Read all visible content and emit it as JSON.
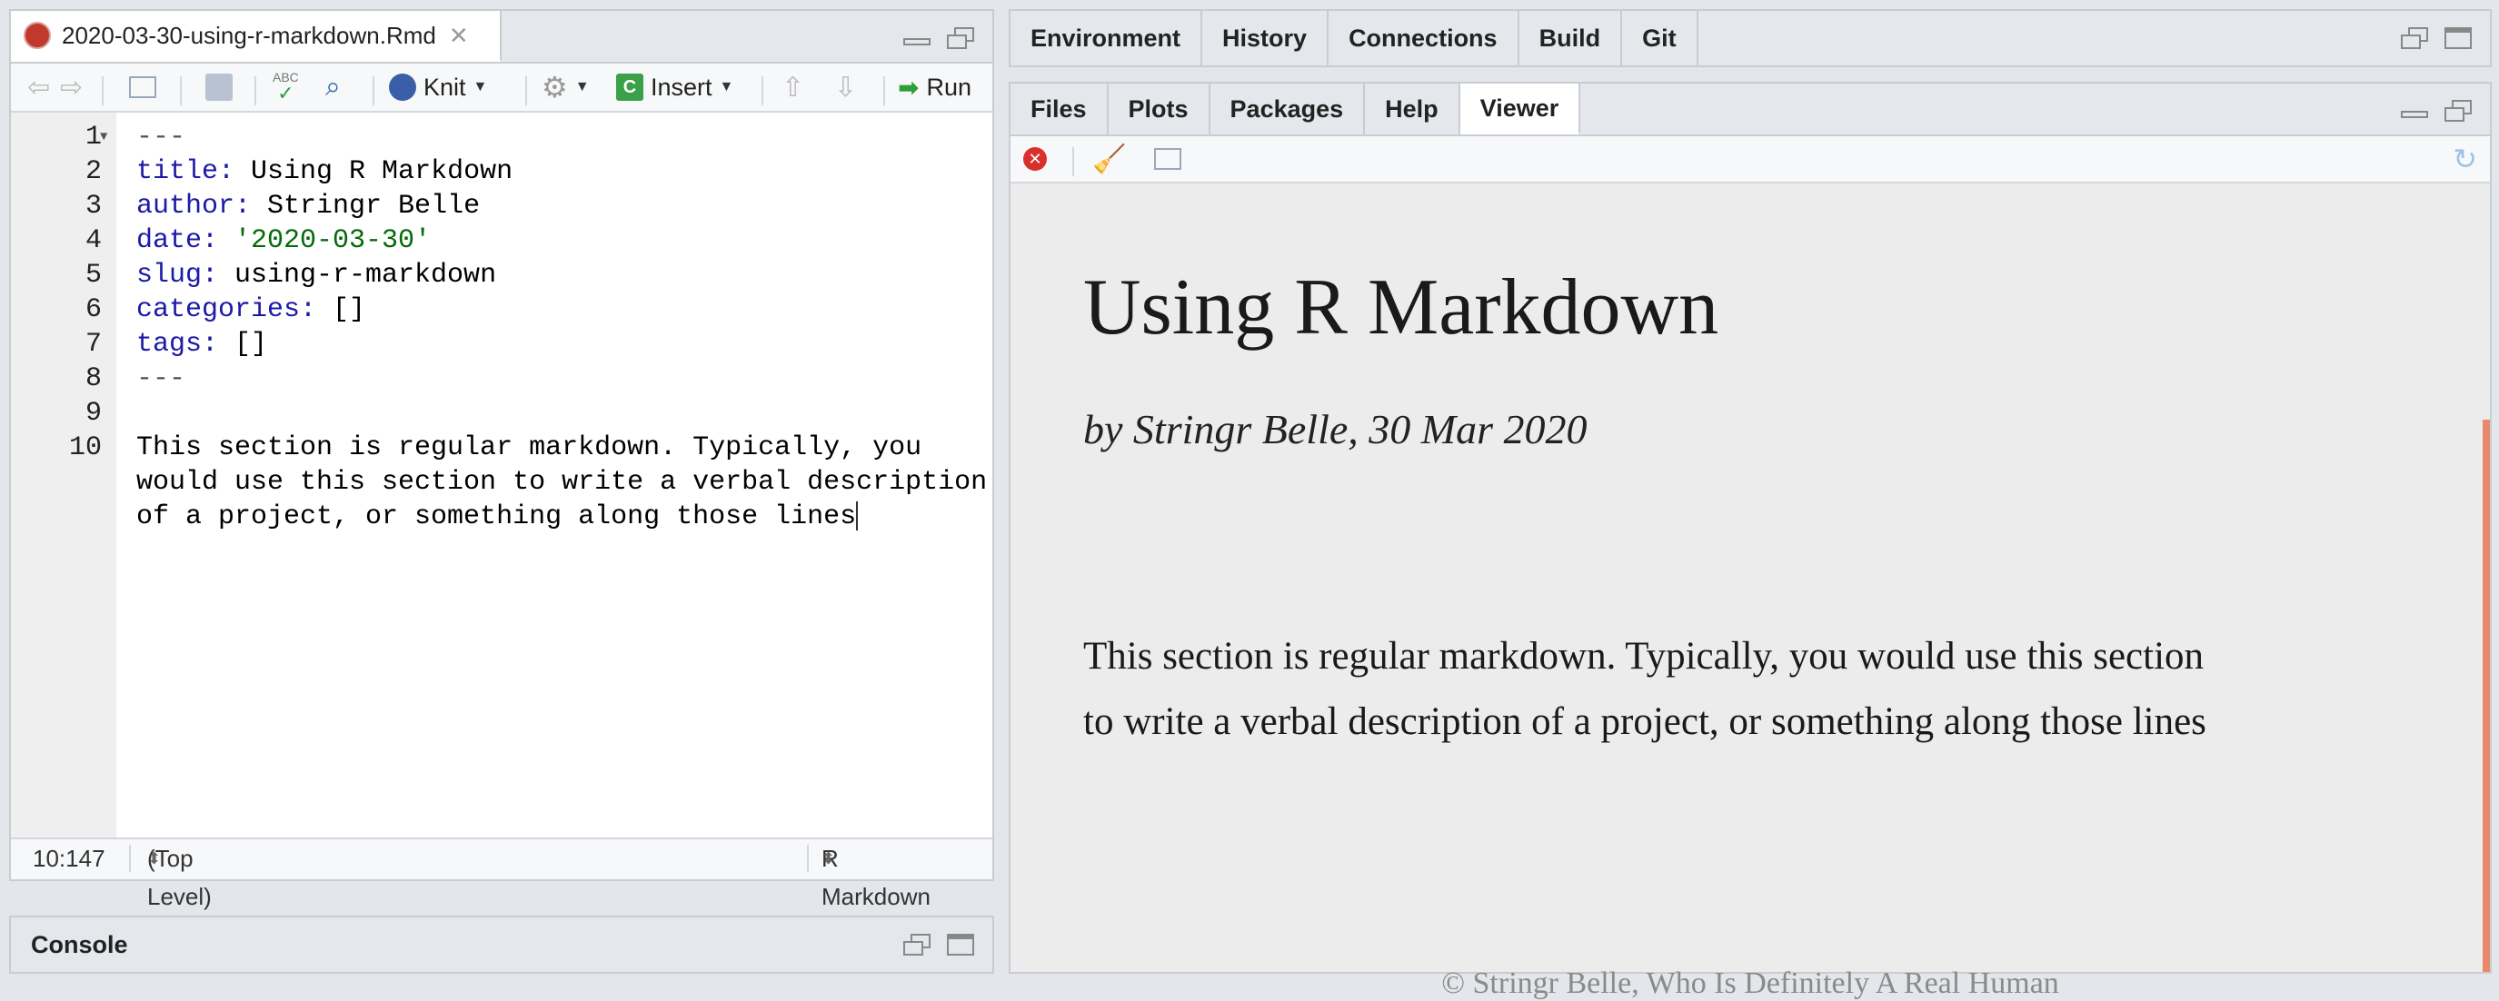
{
  "editor": {
    "file_tab": "2020-03-30-using-r-markdown.Rmd",
    "toolbar": {
      "knit": "Knit",
      "insert": "Insert",
      "run": "Run",
      "abc": "ABC"
    },
    "lines": [
      {
        "n": "1",
        "parts": [
          {
            "t": "---",
            "c": "g"
          }
        ]
      },
      {
        "n": "2",
        "parts": [
          {
            "t": "title:",
            "c": "k"
          },
          {
            "t": " Using R Markdown",
            "c": ""
          }
        ]
      },
      {
        "n": "3",
        "parts": [
          {
            "t": "author:",
            "c": "k"
          },
          {
            "t": " Stringr Belle",
            "c": ""
          }
        ]
      },
      {
        "n": "4",
        "parts": [
          {
            "t": "date:",
            "c": "k"
          },
          {
            "t": " ",
            "c": ""
          },
          {
            "t": "'2020-03-30'",
            "c": "s"
          }
        ]
      },
      {
        "n": "5",
        "parts": [
          {
            "t": "slug:",
            "c": "k"
          },
          {
            "t": " using-r-markdown",
            "c": ""
          }
        ]
      },
      {
        "n": "6",
        "parts": [
          {
            "t": "categories:",
            "c": "k"
          },
          {
            "t": " []",
            "c": ""
          }
        ]
      },
      {
        "n": "7",
        "parts": [
          {
            "t": "tags:",
            "c": "k"
          },
          {
            "t": " []",
            "c": ""
          }
        ]
      },
      {
        "n": "8",
        "parts": [
          {
            "t": "---",
            "c": "g"
          }
        ]
      },
      {
        "n": "9",
        "parts": []
      },
      {
        "n": "10",
        "parts": [
          {
            "t": "This section is regular markdown. Typically, you",
            "c": ""
          }
        ]
      },
      {
        "n": "",
        "parts": [
          {
            "t": "would use this section to write a verbal description",
            "c": ""
          }
        ]
      },
      {
        "n": "",
        "parts": [
          {
            "t": "of a project, or something along those lines",
            "c": ""
          }
        ]
      }
    ],
    "status": {
      "position": "10:147",
      "scope": "(Top Level)",
      "mode": "R Markdown"
    }
  },
  "console": {
    "title": "Console"
  },
  "top_right_tabs": [
    "Environment",
    "History",
    "Connections",
    "Build",
    "Git"
  ],
  "bottom_right_tabs": [
    "Files",
    "Plots",
    "Packages",
    "Help",
    "Viewer"
  ],
  "bottom_right_active": "Viewer",
  "viewer": {
    "title": "Using R Markdown",
    "byline": "by Stringr Belle, 30 Mar 2020",
    "body_line1": "This section is regular markdown. Typically, you would use this section",
    "body_line2": "to write a verbal description of a project, or something along those lines",
    "footer": "© Stringr Belle, Who Is Definitely A Real Human"
  },
  "colors": {
    "accent_scroll": "#e8896a",
    "keyword": "#1a1aa6",
    "string": "#036a07"
  }
}
